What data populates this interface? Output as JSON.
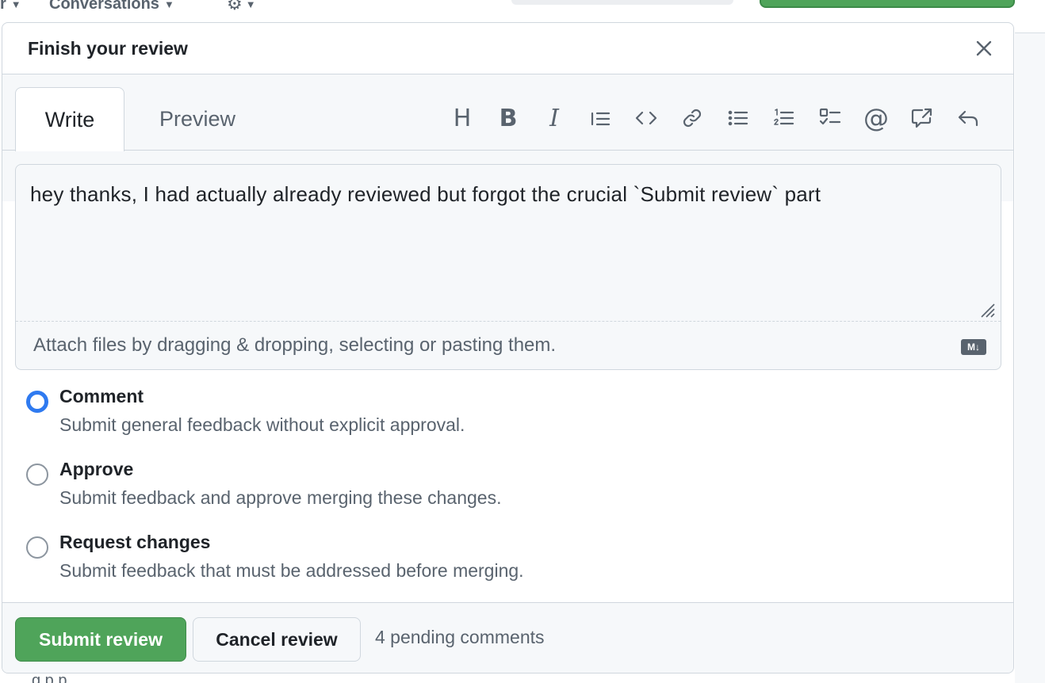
{
  "background": {
    "nav_partial_label": "r",
    "conversations_label": "Conversations",
    "bottom_partial_text": "g                              p          p"
  },
  "dialog": {
    "title": "Finish your review"
  },
  "editor": {
    "tabs": [
      {
        "label": "Write",
        "active": true
      },
      {
        "label": "Preview",
        "active": false
      }
    ],
    "toolbar": {
      "heading_glyph": "H",
      "bold_glyph": "B",
      "italic_glyph": "I",
      "mention_glyph": "@"
    },
    "text_value": "hey thanks, I had actually already reviewed but forgot the crucial `Submit review` part",
    "attach_hint": "Attach files by dragging & dropping, selecting or pasting them.",
    "markdown_badge": "M↓"
  },
  "review_options": [
    {
      "label": "Comment",
      "description": "Submit general feedback without explicit approval.",
      "selected": true
    },
    {
      "label": "Approve",
      "description": "Submit feedback and approve merging these changes.",
      "selected": false
    },
    {
      "label": "Request changes",
      "description": "Submit feedback that must be addressed before merging.",
      "selected": false
    }
  ],
  "footer": {
    "submit_label": "Submit review",
    "cancel_label": "Cancel review",
    "pending_text": "4 pending comments"
  },
  "colors": {
    "accent_green": "#4fa45a",
    "radio_blue": "#2f7af0",
    "border": "#d0d7de",
    "muted_text": "#59636e"
  }
}
